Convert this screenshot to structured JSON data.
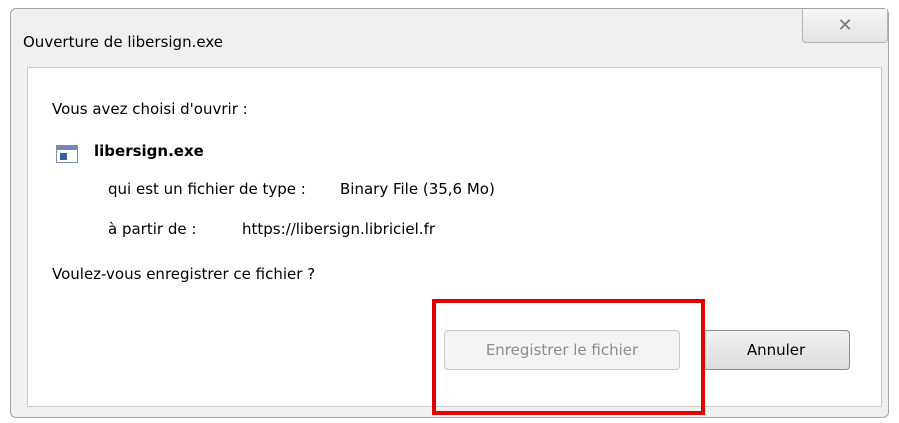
{
  "dialog": {
    "title": "Ouverture de libersign.exe",
    "close_glyph": "✕"
  },
  "body": {
    "intro": "Vous avez choisi d'ouvrir :",
    "filename": "libersign.exe",
    "file_icon": "executable-file-icon",
    "type_label": "qui est un fichier de type :",
    "type_value": "Binary File (35,6 Mo)",
    "from_label": "à partir de :",
    "from_value": "https://libersign.libriciel.fr",
    "question": "Voulez-vous enregistrer ce fichier ?"
  },
  "buttons": {
    "save_label": "Enregistrer le fichier",
    "cancel_label": "Annuler"
  },
  "colors": {
    "highlight": "#e00000"
  }
}
